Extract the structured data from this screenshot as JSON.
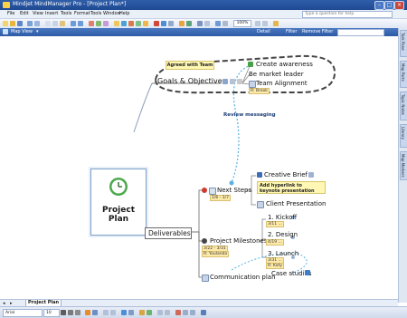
{
  "window": {
    "title": "Mindjet MindManager Pro - [Project Plan*]"
  },
  "menu": [
    "File",
    "Edit",
    "View",
    "Insert",
    "Tools",
    "Format",
    "Tools",
    "Window",
    "Help"
  ],
  "search": {
    "placeholder": "Type a question for help"
  },
  "toolbar": {
    "zoom": "100%"
  },
  "viewbar": {
    "label": "Map View",
    "detail": "Detail",
    "filter": "Filter",
    "remove_filter": "Remove Filter"
  },
  "side_tabs": [
    "Task Pane",
    "Map Parts",
    "Topic Notes",
    "Library",
    "Map Markers"
  ],
  "map": {
    "central": "Project\nPlan",
    "goals": {
      "label": "Goals & Objectives",
      "callout": "Agreed with Team",
      "children": [
        {
          "label": "Create awareness"
        },
        {
          "label": "Be market leader"
        },
        {
          "label": "Team Alignment",
          "tag": "R: Brook"
        }
      ],
      "relationship": "Review messaging"
    },
    "deliverables": {
      "label": "Deliverables",
      "next_steps": {
        "label": "Next Steps",
        "tag": "1/6 - 1/7"
      },
      "creative": {
        "label": "Creative Brief",
        "callout": "Add hyperlink to keynote presentation"
      },
      "client": {
        "label": "Client Presentation"
      },
      "milestones": {
        "label": "Project Milestones",
        "tag1": "3/22 - 3/31",
        "tag2": "R: Youlanda",
        "items": [
          {
            "label": "1. Kickoff",
            "tag": "3/11 ..."
          },
          {
            "label": "2. Design",
            "tag": "4/19 ..."
          },
          {
            "label": "3. Launch",
            "tag": "3/31 ...",
            "tag2": "R: Katy"
          }
        ]
      },
      "comm": {
        "label": "Communication plan"
      },
      "cases": {
        "label": "Case studies"
      }
    }
  },
  "doc_tab": "Project Plan",
  "font": {
    "name": "Arial",
    "size": "10"
  }
}
